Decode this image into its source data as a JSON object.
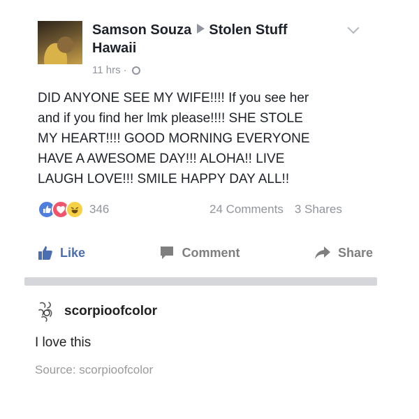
{
  "post": {
    "author": "Samson Souza",
    "group_line1": "Stolen Stuff",
    "group_line2": "Hawaii",
    "time": "11 hrs",
    "text_lines": [
      "DID ANYONE SEE MY WIFE!!!! If you see her",
      "and if you find her lmk please!!!!  SHE STOLE",
      "MY HEART!!!! GOOD MORNING EVERYONE",
      "HAVE A AWESOME DAY!!! ALOHA!! LIVE",
      "LAUGH LOVE!!! SMILE HAPPY DAY ALL!!"
    ],
    "reaction_count": "346",
    "comments": "24 Comments",
    "shares": "3 Shares",
    "icons": [
      "like-reaction-icon",
      "love-reaction-icon",
      "haha-reaction-icon",
      "globe-icon",
      "chevron-down-icon"
    ]
  },
  "actions": {
    "like": "Like",
    "comment": "Comment",
    "share": "Share"
  },
  "tumblr": {
    "username": "scorpioofcolor",
    "comment": "I love this",
    "source": "Source: scorpioofcolor"
  },
  "colors": {
    "like_blue": "#4b6eb3",
    "love_red": "#f0566b",
    "haha_yellow": "#f7d145",
    "muted": "#90949c"
  }
}
